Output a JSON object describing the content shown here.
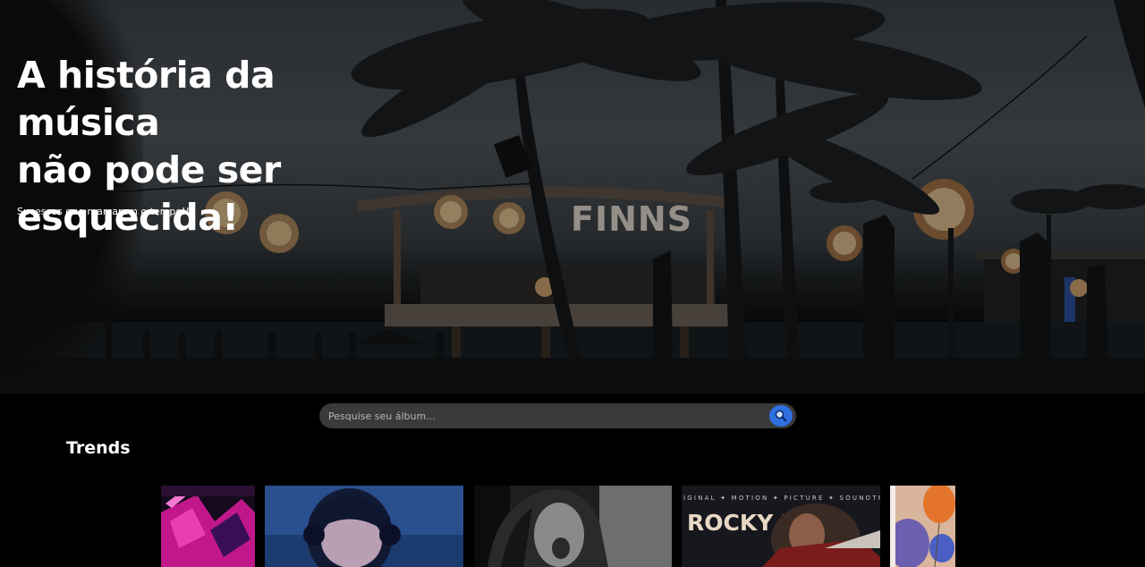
{
  "hero": {
    "title_lines": [
      "A história da música",
      "não pode ser",
      "esquecida!"
    ],
    "subtitle": "Sucessos que marcaram o tempo!!!",
    "sign": "FINNS"
  },
  "search": {
    "placeholder": "Pesquise seu álbum...",
    "button_icon": "search-icon"
  },
  "trends": {
    "title": "Trends",
    "albums": [
      {
        "name": "album-cover-1"
      },
      {
        "name": "album-cover-2"
      },
      {
        "name": "album-cover-3"
      },
      {
        "name": "album-cover-4",
        "cover_text": "ROCKY IV",
        "cover_top_text": "IGINAL ✦ MOTION ✦ PICTURE ✦ SOUNDTR"
      },
      {
        "name": "album-cover-5"
      }
    ]
  },
  "colors": {
    "background": "#000000",
    "search_bg": "#3a3a3a",
    "accent": "#2f6fe0"
  }
}
